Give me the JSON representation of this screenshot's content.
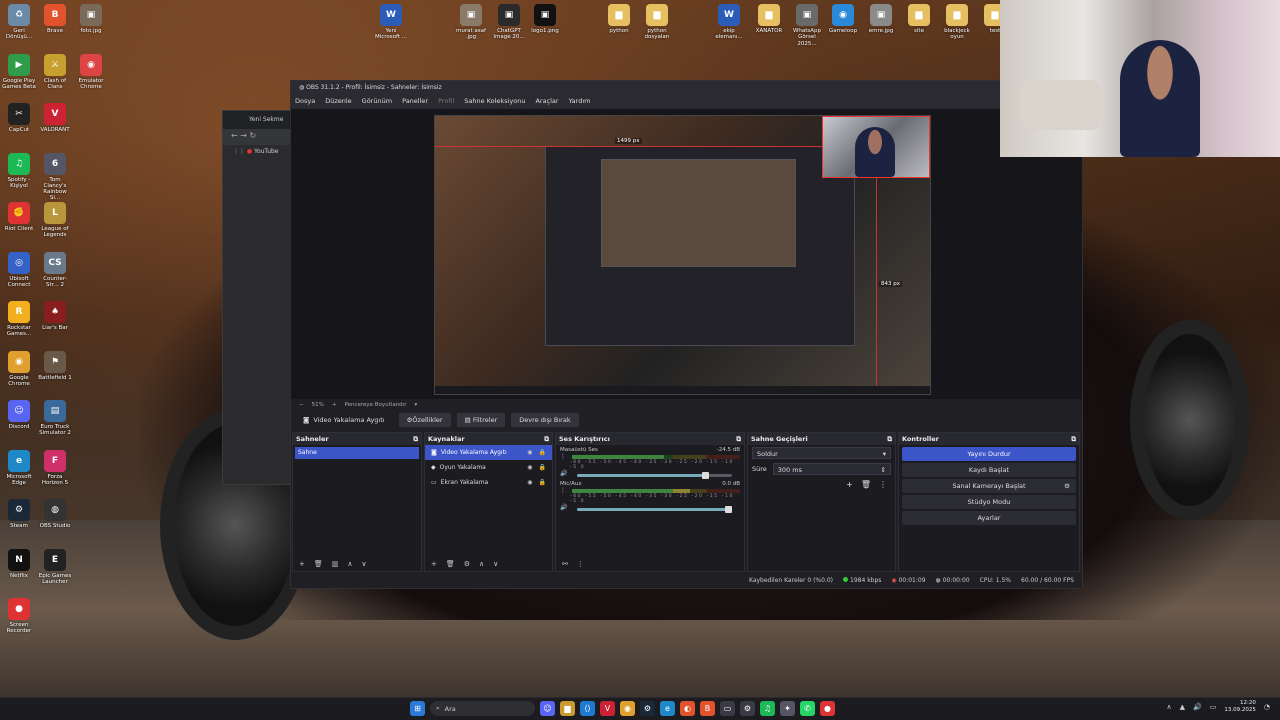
{
  "desktop_left": [
    {
      "label": "Geri Dönüşü...",
      "color": "#6a8aa8",
      "glyph": "♻"
    },
    {
      "label": "Brave",
      "color": "#e2532d",
      "glyph": "B"
    },
    {
      "label": "foto.jpg",
      "color": "#7a6a5a",
      "glyph": "▣"
    },
    {
      "label": "Google Play Games Beta",
      "color": "#2e9c4a",
      "glyph": "▶"
    },
    {
      "label": "Clash of Clans",
      "color": "#c8a030",
      "glyph": "⚔"
    },
    {
      "label": "Emulator Chrome",
      "color": "#d44",
      "glyph": "◉"
    },
    {
      "label": "CapCut",
      "color": "#222",
      "glyph": "✂"
    },
    {
      "label": "VALORANT",
      "color": "#c23",
      "glyph": "V"
    },
    {
      "label": "Spotify - Kişiyol",
      "color": "#1db954",
      "glyph": "♫"
    },
    {
      "label": "Tom Clancy's Rainbow Si...",
      "color": "#556",
      "glyph": "6"
    },
    {
      "label": "Riot Client",
      "color": "#d33",
      "glyph": "✊"
    },
    {
      "label": "League of Legends",
      "color": "#b8963c",
      "glyph": "L"
    },
    {
      "label": "Ubisoft Connect",
      "color": "#3562c6",
      "glyph": "◎"
    },
    {
      "label": "Counter-Str... 2",
      "color": "#6a7a8a",
      "glyph": "CS"
    },
    {
      "label": "Rockstar Games...",
      "color": "#f2b01e",
      "glyph": "R"
    },
    {
      "label": "Liar's Bar",
      "color": "#8a1e1e",
      "glyph": "♠"
    },
    {
      "label": "Google Chrome",
      "color": "#e0a030",
      "glyph": "◉"
    },
    {
      "label": "Battlefield 1",
      "color": "#6a5848",
      "glyph": "⚑"
    },
    {
      "label": "Discord",
      "color": "#5865f2",
      "glyph": "☺"
    },
    {
      "label": "Euro Truck Simulator 2",
      "color": "#3a6a9a",
      "glyph": "▤"
    },
    {
      "label": "Microsoft Edge",
      "color": "#1e88c8",
      "glyph": "e"
    },
    {
      "label": "Forza Horizon 5",
      "color": "#d0306a",
      "glyph": "F"
    },
    {
      "label": "Steam",
      "color": "#1b2838",
      "glyph": "⚙"
    },
    {
      "label": "OBS Studio",
      "color": "#333",
      "glyph": "◍"
    },
    {
      "label": "Netflix",
      "color": "#111",
      "glyph": "N"
    },
    {
      "label": "Epic Games Launcher",
      "color": "#222",
      "glyph": "E"
    },
    {
      "label": "Screen Recorder",
      "color": "#d33",
      "glyph": "●"
    }
  ],
  "desktop_top": [
    {
      "label": "Yeni Microsoft ...",
      "color": "#2b5db8",
      "glyph": "W"
    },
    {
      "label": "murat asaf .jpg",
      "color": "#8a7a6a",
      "glyph": "▣"
    },
    {
      "label": "ChatGPT Image 20...",
      "color": "#2a2a2a",
      "glyph": "▣"
    },
    {
      "label": "logo1.png",
      "color": "#111",
      "glyph": "▣"
    },
    {
      "label": "python",
      "color": "#e6c060",
      "glyph": "▆"
    },
    {
      "label": "python dosyaları",
      "color": "#e6c060",
      "glyph": "▆"
    },
    {
      "label": "ekip elemanı...",
      "color": "#2b5db8",
      "glyph": "W"
    },
    {
      "label": "XANATOR",
      "color": "#e6c060",
      "glyph": "▆"
    },
    {
      "label": "WhatsApp Görsel 2025...",
      "color": "#6a6a6a",
      "glyph": "▣"
    },
    {
      "label": "Gameloop",
      "color": "#2b8ad8",
      "glyph": "◉"
    },
    {
      "label": "emre.jpg",
      "color": "#8a8a8a",
      "glyph": "▣"
    },
    {
      "label": "site",
      "color": "#e6c060",
      "glyph": "▆"
    },
    {
      "label": "blackjeck oyun",
      "color": "#e6c060",
      "glyph": "▆"
    },
    {
      "label": "test",
      "color": "#e6c060",
      "glyph": "▆"
    }
  ],
  "browser": {
    "tab": "Yeni Sekme",
    "bookmark": "YouTube"
  },
  "obs": {
    "title": "OBS 31.1.2 - Profil: İsimsiz - Sahneler: İsimsiz",
    "menu": [
      "Dosya",
      "Düzenle",
      "Görünüm",
      "Paneller",
      "Profil",
      "Sahne Koleksiyonu",
      "Araçlar",
      "Yardım"
    ],
    "preview": {
      "dim_top": "1499 px",
      "dim_right": "843 px"
    },
    "zoom": {
      "value": "51%",
      "mode": "Pencereye Boyutlandır"
    },
    "source_toolbar": {
      "selected": "Video Yakalama Aygıtı",
      "properties": "Özellikler",
      "filters": "Filtreler",
      "deactivate": "Devre dışı Bırak"
    },
    "scenes": {
      "title": "Sahneler",
      "items": [
        "Sahne"
      ]
    },
    "sources": {
      "title": "Kaynaklar",
      "items": [
        {
          "name": "Video Yakalama Aygıtı",
          "icon": "camera",
          "active": true
        },
        {
          "name": "Oyun Yakalama",
          "icon": "gamepad",
          "active": false
        },
        {
          "name": "Ekran Yakalama",
          "icon": "monitor",
          "active": false
        }
      ]
    },
    "mixer": {
      "title": "Ses Karıştırıcı",
      "channels": [
        {
          "name": "Masaüstü Ses",
          "db": "-24.5 dB",
          "level": 0.55,
          "volume": 0.85
        },
        {
          "name": "Mic/Aux",
          "db": "0.0 dB",
          "level": 0.7,
          "volume": 1.0
        }
      ],
      "scale": "-60 -55 -50 -45 -40 -35 -30 -25 -20 -15 -10 -5 0"
    },
    "transitions": {
      "title": "Sahne Geçişleri",
      "type": "Soldur",
      "duration_label": "Süre",
      "duration": "300 ms"
    },
    "controls": {
      "title": "Kontroller",
      "buttons": [
        "Yayını Durdur",
        "Kaydı Başlat",
        "Sanal Kamerayı Başlat",
        "Stüdyo Modu",
        "Ayarlar"
      ]
    },
    "status": {
      "dropped": "Kaybedilen Kareler 0 (%0.0)",
      "bitrate": "1984 kbps",
      "stream_time": "00:01:09",
      "rec_time": "00:00:00",
      "cpu": "CPU: 1.5%",
      "fps": "60.00 / 60.00 FPS"
    }
  },
  "taskbar": {
    "search": "Ara",
    "time": "12:20",
    "date": "13.09.2025"
  }
}
